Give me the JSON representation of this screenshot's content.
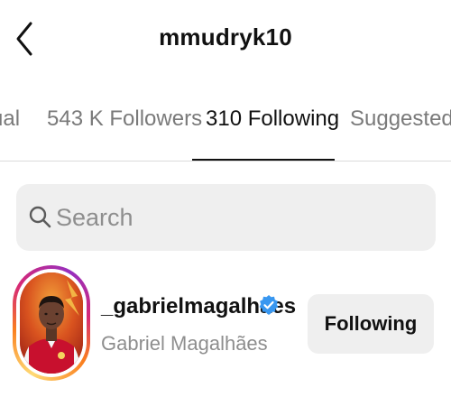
{
  "header": {
    "title": "mmudryk10",
    "back_icon": "chevron-left-icon"
  },
  "tabs": [
    {
      "label": "ual",
      "active": false
    },
    {
      "label": "543 K Followers",
      "active": false
    },
    {
      "label": "310 Following",
      "active": true
    },
    {
      "label": "Suggested",
      "active": false
    }
  ],
  "search": {
    "placeholder": "Search",
    "value": "",
    "icon": "search-icon"
  },
  "accounts": [
    {
      "username": "_gabrielmagalhaes",
      "full_name": "Gabriel Magalhães",
      "verified": true,
      "has_story_ring": true,
      "button_label": "Following"
    }
  ],
  "colors": {
    "background": "#ffffff",
    "text_primary": "#111111",
    "text_secondary": "#8e8e8e",
    "tab_inactive": "#7a7a7a",
    "search_bg": "#efefef",
    "button_bg": "#efefef",
    "verified_blue": "#3897f0",
    "divider": "#dbdbdb"
  }
}
